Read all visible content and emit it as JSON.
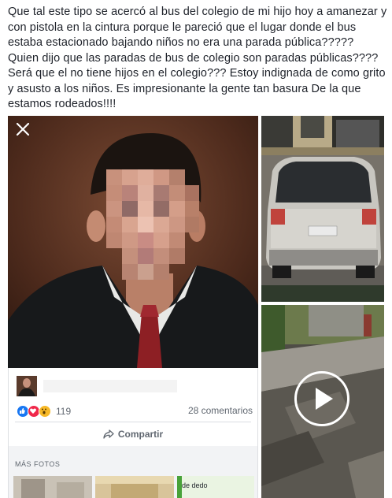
{
  "post": {
    "text": "Que tal este tipo se acercó al bus del colegio de mi hijo hoy a amanezar y con pistola en la cintura porque le pareció que el lugar donde el bus estaba estacionado bajando niños no era una parada pública????? Quien dijo que las paradas de bus de colegio son paradas públicas???? Será que el no tiene hijos en el colegio??? Estoy indignada de como grito y asusto a los niños. Es impresionante la gente tan basura De la que estamos rodeados!!!!"
  },
  "photo_card": {
    "reaction_count": "119",
    "comments": "28 comentarios",
    "share_label": "Compartir",
    "more_photos_label": "MÁS FOTOS",
    "thumb_caption": "de dedo"
  },
  "colors": {
    "like": "#1877f2",
    "love": "#f0284a",
    "wow": "#f7b928"
  },
  "icons": [
    "close-icon",
    "like-icon",
    "love-icon",
    "wow-icon",
    "share-icon",
    "play-icon"
  ]
}
